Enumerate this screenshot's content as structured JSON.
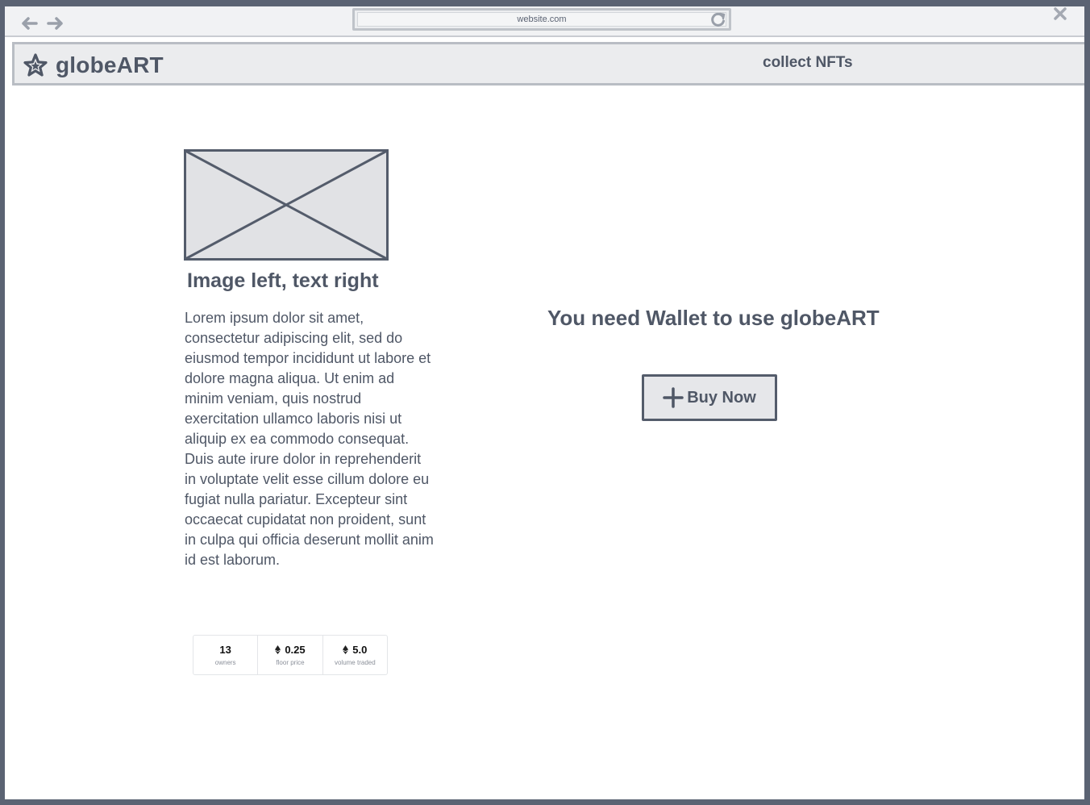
{
  "browser": {
    "url": "website.com",
    "back_icon": "arrow-left-icon",
    "forward_icon": "arrow-right-icon",
    "reload_icon": "reload-icon",
    "close_icon": "close-icon"
  },
  "header": {
    "logo_icon": "star-icon",
    "brand": "globeART",
    "nav_link": "collect NFTs"
  },
  "main": {
    "image_alt": "image-placeholder",
    "title": "Image left, text right",
    "body": "Lorem ipsum dolor sit amet, consectetur adipiscing elit, sed do eiusmod tempor incididunt ut labore et dolore magna aliqua. Ut enim ad minim veniam, quis nostrud exercitation ullamco laboris nisi ut aliquip ex ea commodo consequat. Duis aute irure dolor in reprehenderit in voluptate velit esse cillum dolore eu fugiat nulla pariatur. Excepteur sint occaecat cupidatat non proident, sunt in culpa qui officia deserunt mollit anim id est laborum.",
    "stats": [
      {
        "value": "13",
        "label": "owners",
        "icon": ""
      },
      {
        "value": "0.25",
        "label": "floor price",
        "icon": "ethereum-icon"
      },
      {
        "value": "5.0",
        "label": "volume traded",
        "icon": "ethereum-icon"
      }
    ]
  },
  "wallet": {
    "message": "You need Wallet to use globeART",
    "button_label": "Buy Now",
    "button_icon": "plus-icon"
  },
  "colors": {
    "ink": "#4f5766",
    "frame": "#5b6373",
    "header_bg": "#ebecee",
    "button_bg": "#e6e7ea"
  }
}
